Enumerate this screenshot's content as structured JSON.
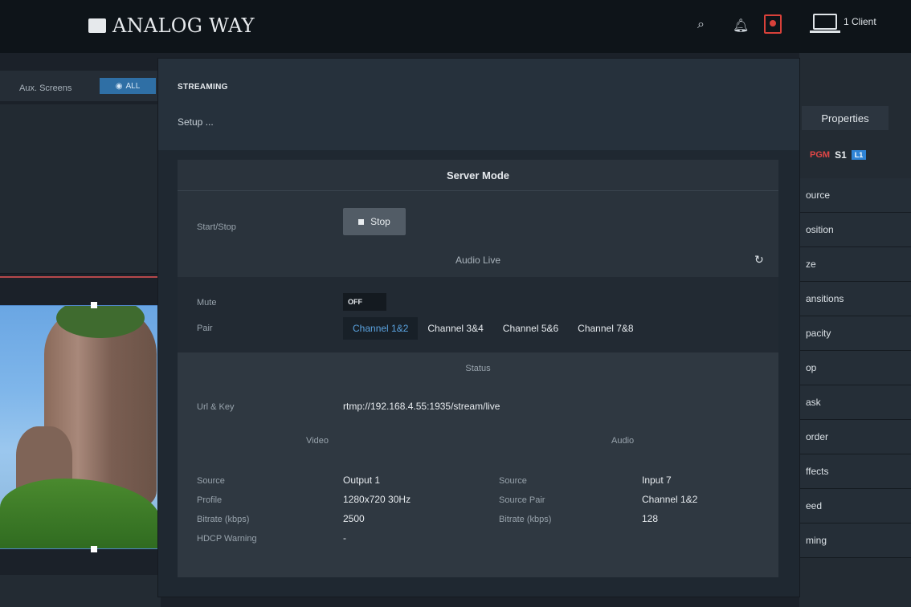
{
  "topbar": {
    "brand": "ANALOG WAY",
    "clients": "1 Client"
  },
  "left": {
    "aux_label": "Aux. Screens",
    "aux_all": "ALL"
  },
  "right": {
    "properties_tab": "Properties",
    "pgm": "PGM",
    "screen": "S1",
    "layer": "L1",
    "items": [
      "ource",
      "osition",
      "ze",
      "ansitions",
      "pacity",
      "op",
      "ask",
      "order",
      "ffects",
      "eed",
      "ming"
    ]
  },
  "modal": {
    "title": "STREAMING",
    "setup": "Setup ...",
    "card_title": "Server Mode",
    "start_stop_label": "Start/Stop",
    "stop_button": "Stop",
    "audio_live": "Audio Live",
    "mute_label": "Mute",
    "mute_state": "OFF",
    "pair_label": "Pair",
    "pairs": [
      "Channel 1&2",
      "Channel 3&4",
      "Channel 5&6",
      "Channel 7&8"
    ],
    "selected_pair_index": 0,
    "status_title": "Status",
    "url_label": "Url & Key",
    "url_value": "rtmp://192.168.4.55:1935/stream/live",
    "video_head": "Video",
    "audio_head": "Audio",
    "video": {
      "source_label": "Source",
      "source": "Output 1",
      "profile_label": "Profile",
      "profile": "1280x720 30Hz",
      "bitrate_label": "Bitrate (kbps)",
      "bitrate": "2500",
      "hdcp_label": "HDCP Warning",
      "hdcp": "-"
    },
    "audio": {
      "source_label": "Source",
      "source": "Input 7",
      "pair_label": "Source Pair",
      "pair": "Channel 1&2",
      "bitrate_label": "Bitrate (kbps)",
      "bitrate": "128"
    }
  },
  "colors": {
    "accent": "#2f84d6",
    "alert": "#d9413a",
    "pgm": "#e04646"
  }
}
